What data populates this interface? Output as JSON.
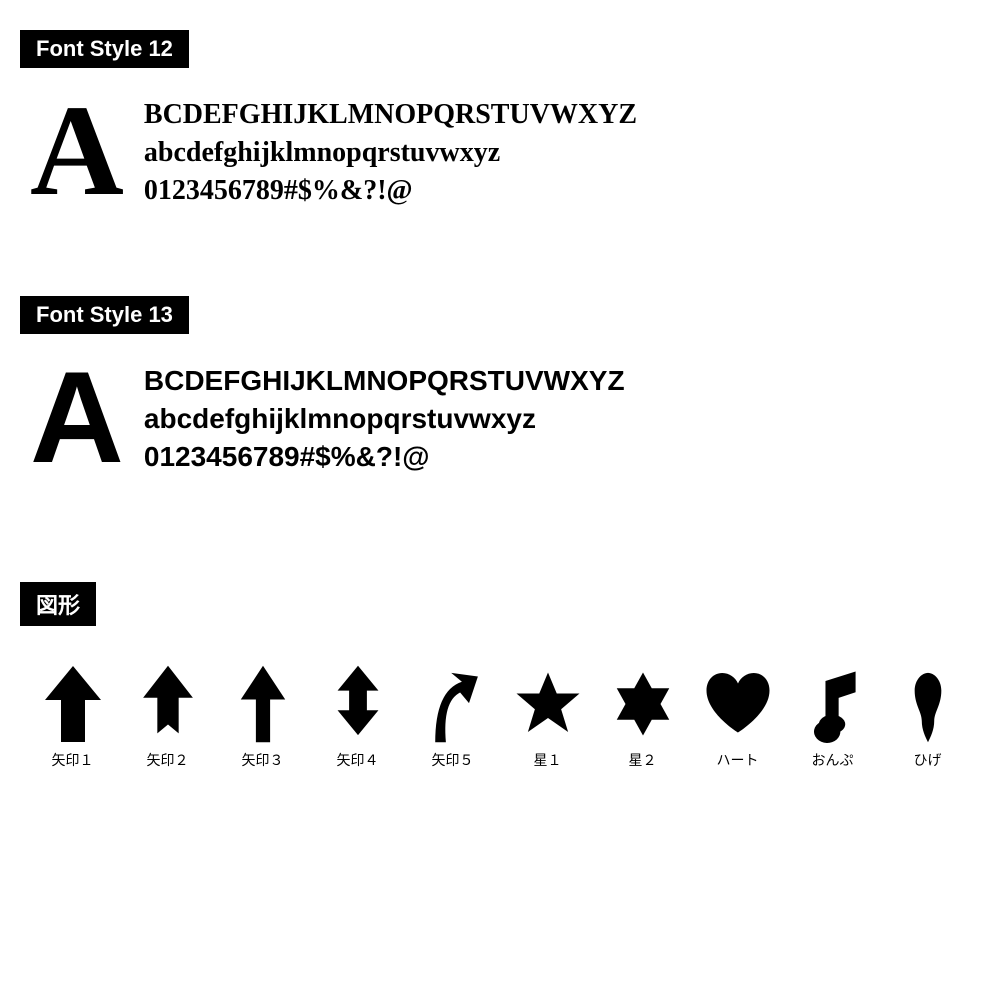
{
  "font_style_12": {
    "label": "Font Style 12",
    "big_letter": "A",
    "lines": [
      "BCDEFGHIJKLMNOPQRSTUVWXYZ",
      "abcdefghijklmnopqrstuvwxyz",
      "0123456789#$%&?!@"
    ]
  },
  "font_style_13": {
    "label": "Font Style 13",
    "big_letter": "A",
    "lines": [
      "BCDEFGHIJKLMNOPQRSTUVWXYZ",
      "abcdefghijklmnopqrstuvwxyz",
      "0123456789#$%&?!@"
    ]
  },
  "shapes_section": {
    "label": "図形",
    "shapes": [
      {
        "name": "矢印1",
        "id": "arrow1"
      },
      {
        "name": "矢印2",
        "id": "arrow2"
      },
      {
        "name": "矢印3",
        "id": "arrow3"
      },
      {
        "name": "矢印4",
        "id": "arrow4"
      },
      {
        "name": "矢印5",
        "id": "arrow5"
      },
      {
        "name": "星１",
        "id": "star1"
      },
      {
        "name": "星２",
        "id": "star2"
      },
      {
        "name": "ハート",
        "id": "heart"
      },
      {
        "name": "おんぷ",
        "id": "music"
      },
      {
        "name": "ひげ",
        "id": "moustache"
      }
    ]
  }
}
